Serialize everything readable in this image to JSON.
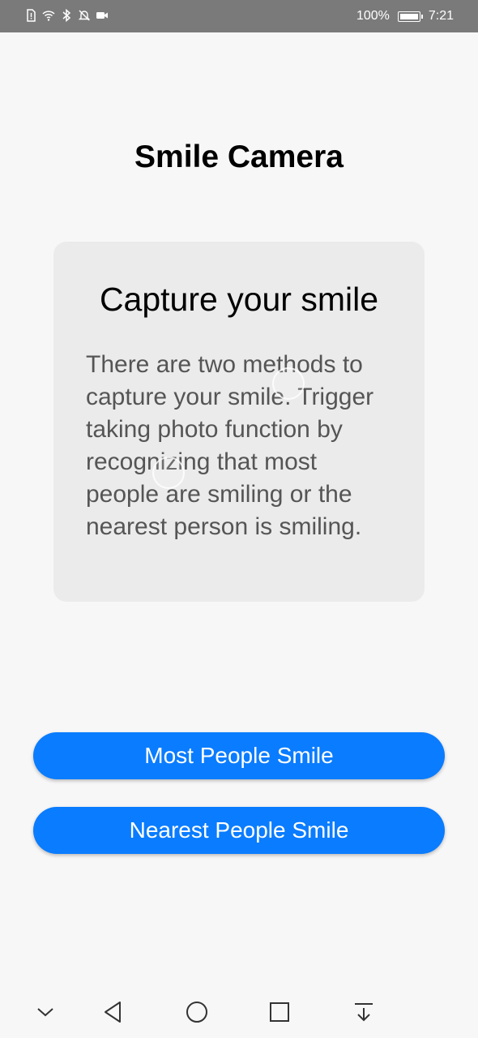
{
  "status_bar": {
    "battery_percent": "100%",
    "time": "7:21",
    "icons": [
      "sim-alert-icon",
      "wifi-icon",
      "bluetooth-icon",
      "notifications-off-icon",
      "video-icon"
    ]
  },
  "app": {
    "title": "Smile Camera"
  },
  "card": {
    "title": "Capture your smile",
    "body": "There are two methods to capture your smile. Trigger taking photo function by recognizing that most people are smiling or the nearest person is smiling."
  },
  "buttons": {
    "most_people": "Most People Smile",
    "nearest_people": "Nearest People Smile"
  },
  "nav": {
    "icons": [
      "collapse-icon",
      "back-icon",
      "home-icon",
      "recents-icon",
      "notification-pull-icon"
    ]
  },
  "colors": {
    "accent": "#0a7cff",
    "card_background": "#ebebeb",
    "status_bar": "#7a7a7a"
  }
}
